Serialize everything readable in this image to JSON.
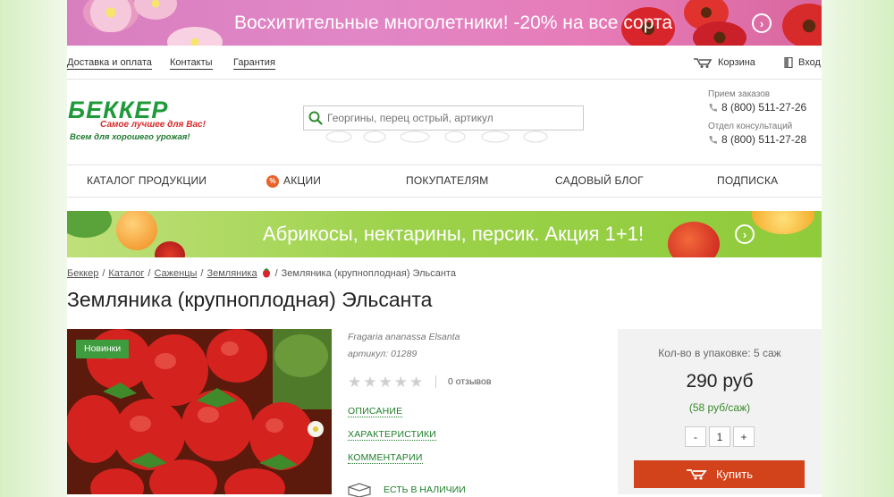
{
  "top_banner": {
    "text": "Восхитительные многолетники! -20% на все сорта",
    "arrow": "›"
  },
  "top_links": [
    "Доставка и оплата",
    "Контакты",
    "Гарантия"
  ],
  "cart_label": "Корзина",
  "login_label": "Вход",
  "logo": {
    "name": "БЕККЕР",
    "slogan": "Самое лучшее для Вас!",
    "tagline": "Всем для хорошего урожая!"
  },
  "search": {
    "placeholder": "Георгины, перец острый, артикул"
  },
  "contacts": {
    "orders_label": "Прием заказов",
    "orders_phone": "8 (800) 511-27-26",
    "consult_label": "Отдел консультаций",
    "consult_phone": "8 (800) 511-27-28"
  },
  "nav": {
    "catalog": "КАТАЛОГ ПРОДУКЦИИ",
    "promo_badge": "%",
    "promo": "АКЦИИ",
    "buyers": "ПОКУПАТЕЛЯМ",
    "blog": "САДОВЫЙ БЛОГ",
    "subscribe": "ПОДПИСКА"
  },
  "mid_banner": {
    "text": "Абрикосы, нектарины, персик. Акция 1+1!",
    "arrow": "›"
  },
  "breadcrumb": [
    "Беккер",
    "Каталог",
    "Саженцы",
    "Земляника",
    "Земляника (крупноплодная) Эльсанта"
  ],
  "breadcrumb_sep": "/",
  "product": {
    "title": "Земляника (крупноплодная) Эльсанта",
    "badge": "Новинки",
    "latin_name": "Fragaria ananassa Elsanta",
    "sku": "артикул: 01289",
    "rating": 0,
    "reviews": "0 отзывов",
    "tabs": [
      "ОПИСАНИЕ",
      "ХАРАКТЕРИСТИКИ",
      "КОММЕНТАРИИ"
    ],
    "stock": "ЕСТЬ В НАЛИЧИИ"
  },
  "buy": {
    "pack": "Кол-во в упаковке: 5 саж",
    "price": "290 руб",
    "unit_price": "(58 руб/саж)",
    "minus": "-",
    "qty": "1",
    "plus": "+",
    "button": "Купить"
  },
  "colors": {
    "brand_green": "#1f9a3a",
    "buy_button": "#d2431b",
    "link_green": "#1e7e2a"
  }
}
